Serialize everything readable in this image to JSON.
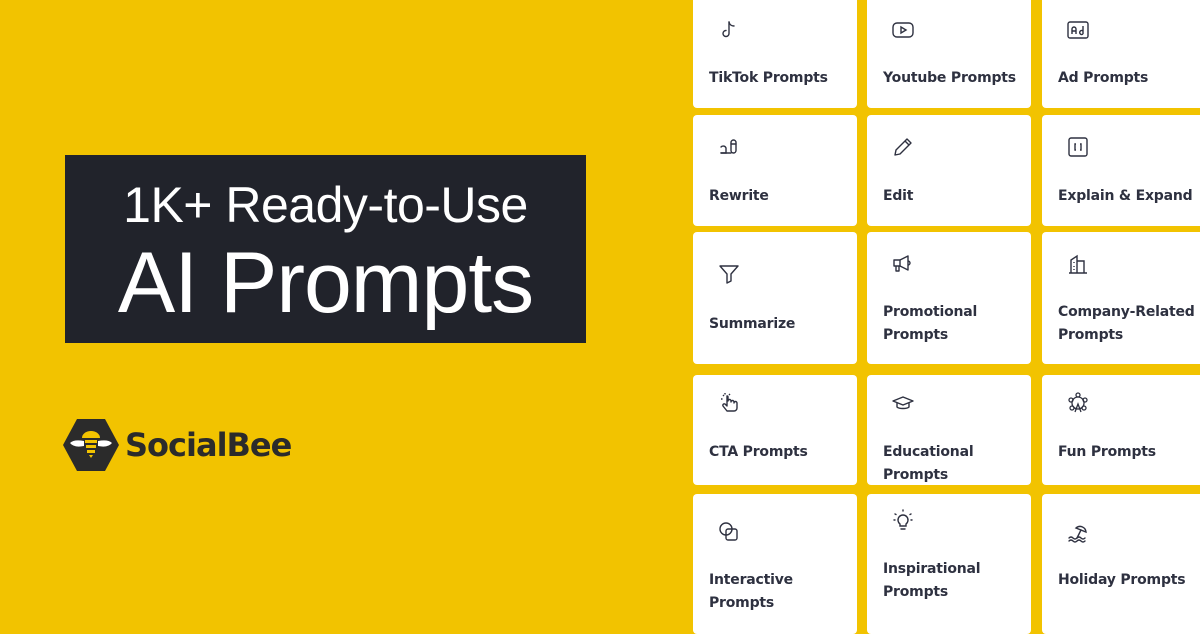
{
  "headline": {
    "line1": "1K+ Ready-to-Use",
    "line2": "AI Prompts"
  },
  "brand": {
    "name": "SocialBee",
    "colors": {
      "background": "#f2c300",
      "dark": "#21232b",
      "logo_dark": "#2b2b2b"
    }
  },
  "cards": [
    {
      "icon": "tiktok-icon",
      "label": "TikTok Prompts"
    },
    {
      "icon": "youtube-icon",
      "label": "Youtube Prompts"
    },
    {
      "icon": "ad-icon",
      "label": "Ad Prompts"
    },
    {
      "icon": "rewrite-icon",
      "label": "Rewrite"
    },
    {
      "icon": "pencil-icon",
      "label": "Edit"
    },
    {
      "icon": "brackets-icon",
      "label": "Explain & Expand"
    },
    {
      "icon": "funnel-icon",
      "label": "Summarize"
    },
    {
      "icon": "megaphone-icon",
      "label": "Promotional Prompts"
    },
    {
      "icon": "building-icon",
      "label": "Company-Related Prompts"
    },
    {
      "icon": "click-hand-icon",
      "label": "CTA Prompts"
    },
    {
      "icon": "graduation-cap-icon",
      "label": "Educational Prompts"
    },
    {
      "icon": "ferris-wheel-icon",
      "label": "Fun Prompts"
    },
    {
      "icon": "overlap-shapes-icon",
      "label": "Interactive Prompts"
    },
    {
      "icon": "lightbulb-icon",
      "label": "Inspirational Prompts"
    },
    {
      "icon": "beach-umbrella-icon",
      "label": "Holiday Prompts"
    }
  ]
}
